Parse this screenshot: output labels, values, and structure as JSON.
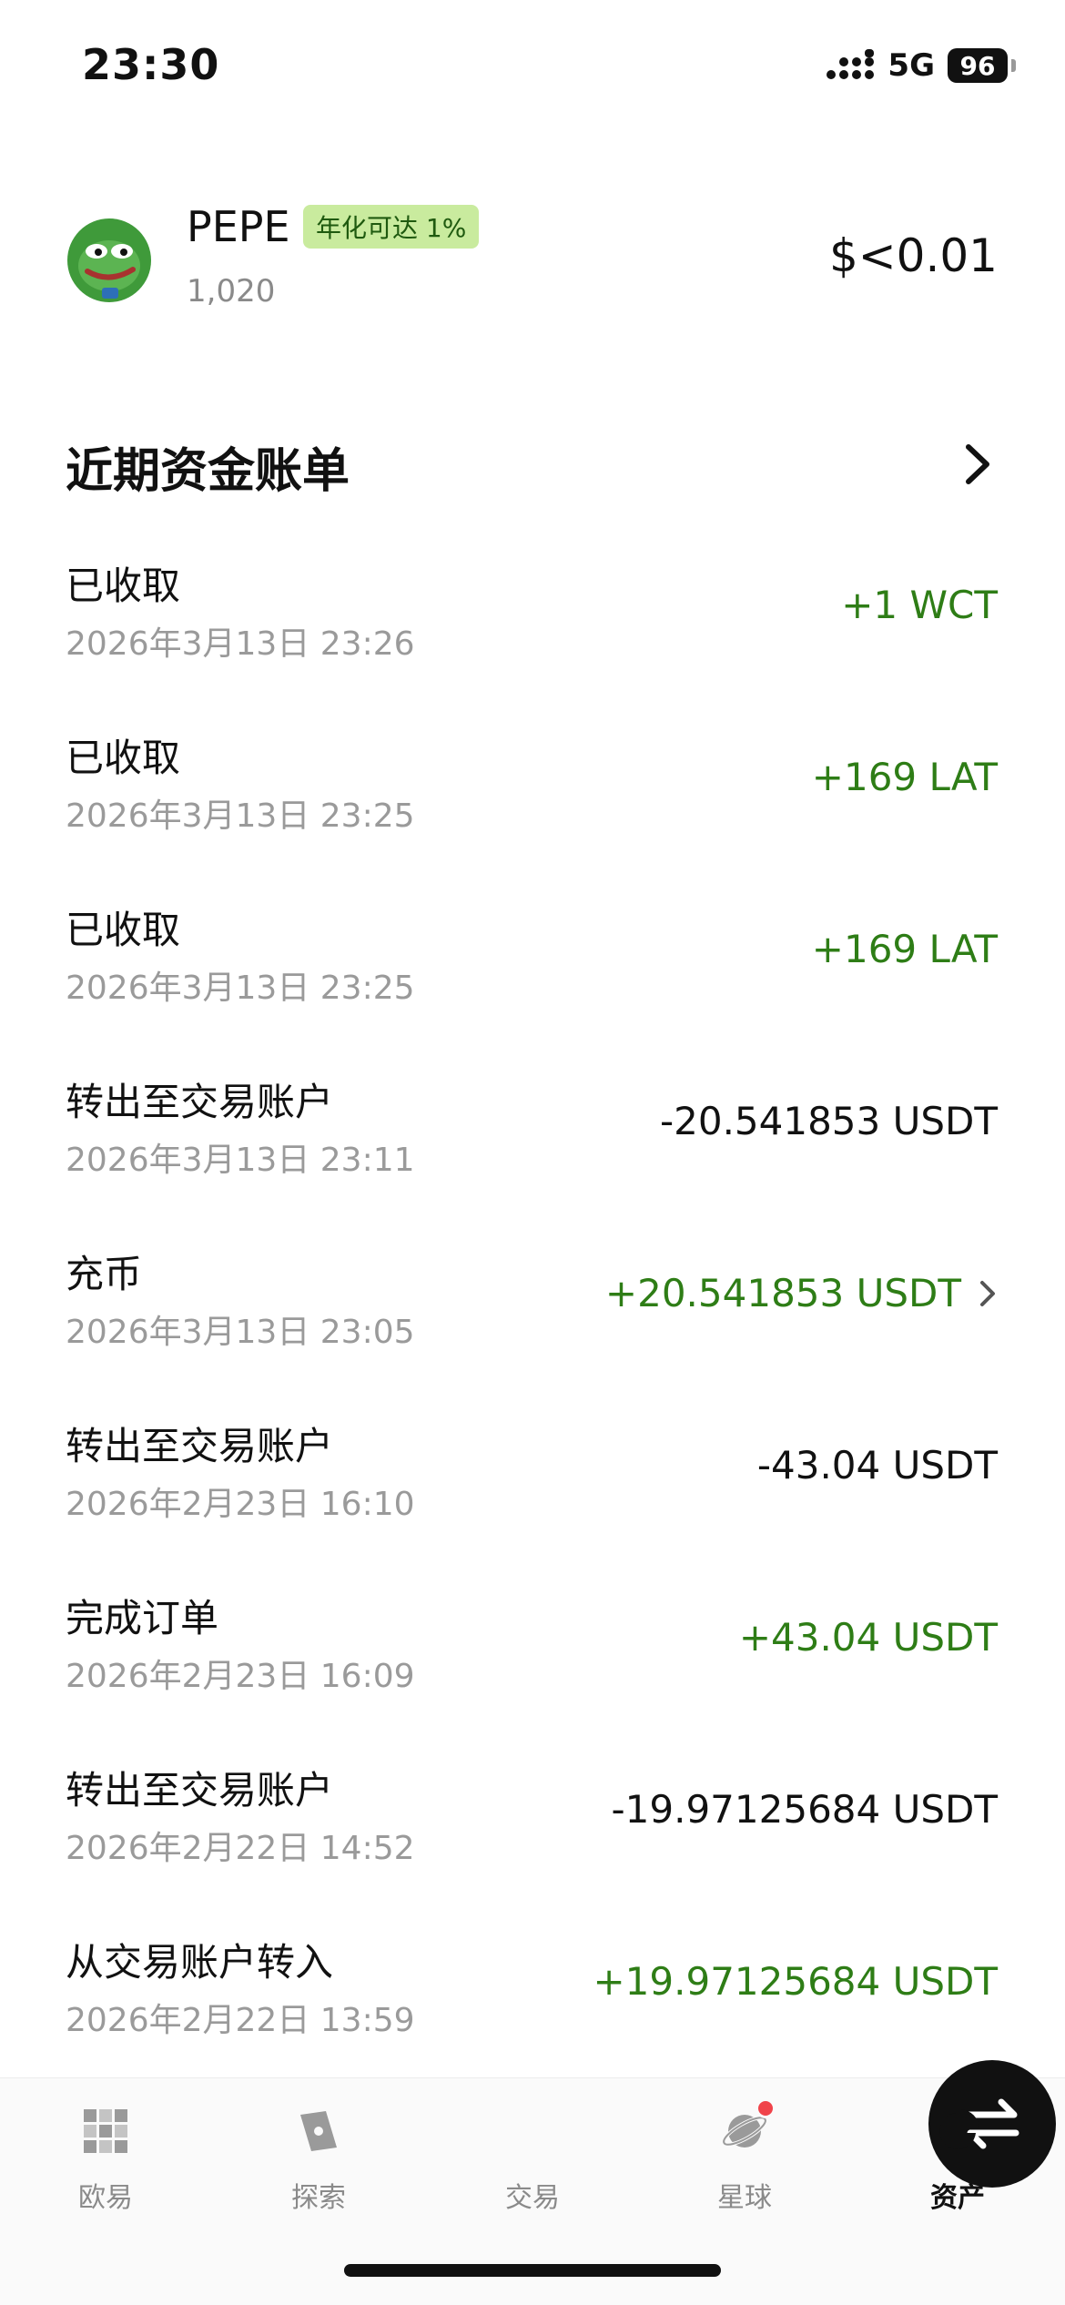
{
  "status_bar": {
    "time": "23:30",
    "network": "5G",
    "battery": "96"
  },
  "token": {
    "name": "PEPE",
    "badge": "年化可达 1%",
    "amount": "1,020",
    "value": "$<0.01",
    "avatar_icon": "pepe-frog-icon"
  },
  "section": {
    "title": "近期资金账单"
  },
  "transactions": [
    {
      "title": "已收取",
      "date": "2026年3月13日 23:26",
      "amount": "+1 WCT",
      "positive": true
    },
    {
      "title": "已收取",
      "date": "2026年3月13日 23:25",
      "amount": "+169 LAT",
      "positive": true
    },
    {
      "title": "已收取",
      "date": "2026年3月13日 23:25",
      "amount": "+169 LAT",
      "positive": true
    },
    {
      "title": "转出至交易账户",
      "date": "2026年3月13日 23:11",
      "amount": "-20.541853 USDT",
      "positive": false
    },
    {
      "title": "充币",
      "date": "2026年3月13日 23:05",
      "amount": "+20.541853 USDT",
      "positive": true,
      "has_chevron": true
    },
    {
      "title": "转出至交易账户",
      "date": "2026年2月23日 16:10",
      "amount": "-43.04 USDT",
      "positive": false
    },
    {
      "title": "完成订单",
      "date": "2026年2月23日 16:09",
      "amount": "+43.04 USDT",
      "positive": true
    },
    {
      "title": "转出至交易账户",
      "date": "2026年2月22日 14:52",
      "amount": "-19.97125684 USDT",
      "positive": false
    },
    {
      "title": "从交易账户转入",
      "date": "2026年2月22日 13:59",
      "amount": "+19.97125684 USDT",
      "positive": true
    }
  ],
  "bottom_nav": {
    "items": [
      {
        "label": "欧易",
        "icon": "okx-logo-icon"
      },
      {
        "label": "探索",
        "icon": "compass-icon"
      },
      {
        "label": "交易",
        "icon": "swap-arrows-icon"
      },
      {
        "label": "星球",
        "icon": "planet-icon"
      },
      {
        "label": "资产",
        "icon": "pie-chart-icon",
        "active": true
      }
    ]
  },
  "colors": {
    "positive": "#2e7d16",
    "negative": "#111111",
    "muted": "#9a9a9a",
    "badge_bg": "#c9eb9e",
    "badge_text": "#1f5a0f",
    "notification_dot": "#f0434a"
  }
}
